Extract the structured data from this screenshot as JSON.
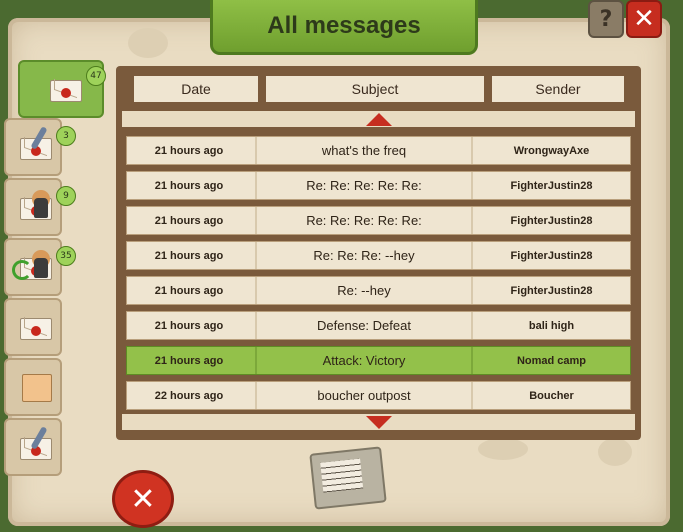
{
  "title": "All messages",
  "corner_buttons": {
    "help_label": "?",
    "close_label": "✕"
  },
  "tabs": [
    {
      "name": "inbox",
      "icon": "envelope-icon",
      "count": "47",
      "active": true
    },
    {
      "name": "reports",
      "icon": "quill-envelope-icon",
      "count": "3"
    },
    {
      "name": "battles",
      "icon": "knight-envelope-icon",
      "count": "9"
    },
    {
      "name": "returns",
      "icon": "return-envelope-icon",
      "count": "35"
    },
    {
      "name": "sent",
      "icon": "sent-envelope-icon",
      "count": ""
    },
    {
      "name": "archive",
      "icon": "folder-icon",
      "count": ""
    },
    {
      "name": "drafts",
      "icon": "quill-letter-icon",
      "count": ""
    }
  ],
  "table": {
    "columns": [
      "Date",
      "Subject",
      "Sender"
    ],
    "rows": [
      {
        "date": "21 hours ago",
        "subject": "what's the freq",
        "sender": "WrongwayAxe",
        "selected": false
      },
      {
        "date": "21 hours ago",
        "subject": "Re: Re: Re: Re: Re:",
        "sender": "FighterJustin28",
        "selected": false
      },
      {
        "date": "21 hours ago",
        "subject": "Re: Re: Re: Re: Re:",
        "sender": "FighterJustin28",
        "selected": false
      },
      {
        "date": "21 hours ago",
        "subject": "Re: Re: Re: --hey",
        "sender": "FighterJustin28",
        "selected": false
      },
      {
        "date": "21 hours ago",
        "subject": "Re: --hey",
        "sender": "FighterJustin28",
        "selected": false
      },
      {
        "date": "21 hours ago",
        "subject": "Defense: Defeat",
        "sender": "bali high",
        "selected": false
      },
      {
        "date": "21 hours ago",
        "subject": "Attack: Victory",
        "sender": "Nomad camp",
        "selected": true
      },
      {
        "date": "22 hours ago",
        "subject": "boucher outpost",
        "sender": "Boucher",
        "selected": false
      }
    ]
  },
  "buttons": {
    "delete_label": "✕"
  },
  "colors": {
    "accent_green": "#93c14a",
    "danger_red": "#c62d1f",
    "parchment": "#e9dcc2"
  }
}
